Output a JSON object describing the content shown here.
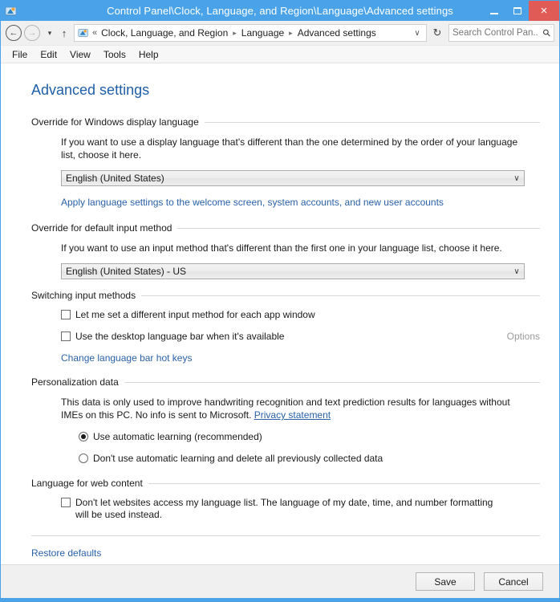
{
  "window": {
    "title": "Control Panel\\Clock, Language, and Region\\Language\\Advanced settings",
    "minimize_label": "Minimize",
    "maximize_label": "Maximize",
    "close_label": "×"
  },
  "nav": {
    "back_glyph": "←",
    "forward_glyph": "→",
    "history_glyph": "▾",
    "up_glyph": "↑",
    "separator": "«",
    "crumb_arrow": "▸",
    "breadcrumbs": [
      "Clock, Language, and Region",
      "Language",
      "Advanced settings"
    ],
    "address_dropdown_glyph": "∨",
    "refresh_glyph": "↻"
  },
  "search": {
    "placeholder": "Search Control Pan...",
    "icon": "search-icon",
    "value": ""
  },
  "menubar": {
    "items": [
      "File",
      "Edit",
      "View",
      "Tools",
      "Help"
    ]
  },
  "page": {
    "title": "Advanced settings"
  },
  "sections": {
    "display_language": {
      "header": "Override for Windows display language",
      "description": "If you want to use a display language that's different than the one determined by the order of your language list, choose it here.",
      "combo_value": "English (United States)",
      "combo_arrow": "∨",
      "link": "Apply language settings to the welcome screen, system accounts, and new user accounts"
    },
    "input_method": {
      "header": "Override for default input method",
      "description": "If you want to use an input method that's different than the first one in your language list, choose it here.",
      "combo_value": "English (United States) - US",
      "combo_arrow": "∨"
    },
    "switching": {
      "header": "Switching input methods",
      "checkbox_app_window": {
        "label": "Let me set a different input method for each app window",
        "checked": false
      },
      "checkbox_language_bar": {
        "label": "Use the desktop language bar when it's available",
        "checked": false
      },
      "options_label": "Options",
      "hotkeys_link": "Change language bar hot keys"
    },
    "personalization": {
      "header": "Personalization data",
      "description_before": "This data is only used to improve handwriting recognition and text prediction results for languages without IMEs on this PC. No info is sent to Microsoft. ",
      "privacy_link": "Privacy statement",
      "radio_auto": {
        "label": "Use automatic learning (recommended)",
        "checked": true
      },
      "radio_no_auto": {
        "label": "Don't use automatic learning and delete all previously collected data",
        "checked": false
      }
    },
    "web_content": {
      "header": "Language for web content",
      "checkbox_block": {
        "label": "Don't let websites access my language list. The language of my date, time, and number formatting will be used instead.",
        "checked": false
      }
    },
    "restore": {
      "link": "Restore defaults"
    }
  },
  "footer": {
    "save_label": "Save",
    "cancel_label": "Cancel"
  },
  "colors": {
    "titlebar": "#4aa3e8",
    "close_button": "#e05a56",
    "link": "#2a61a8",
    "page_title": "#1f5fa8",
    "chrome": "#f0f0f0"
  }
}
